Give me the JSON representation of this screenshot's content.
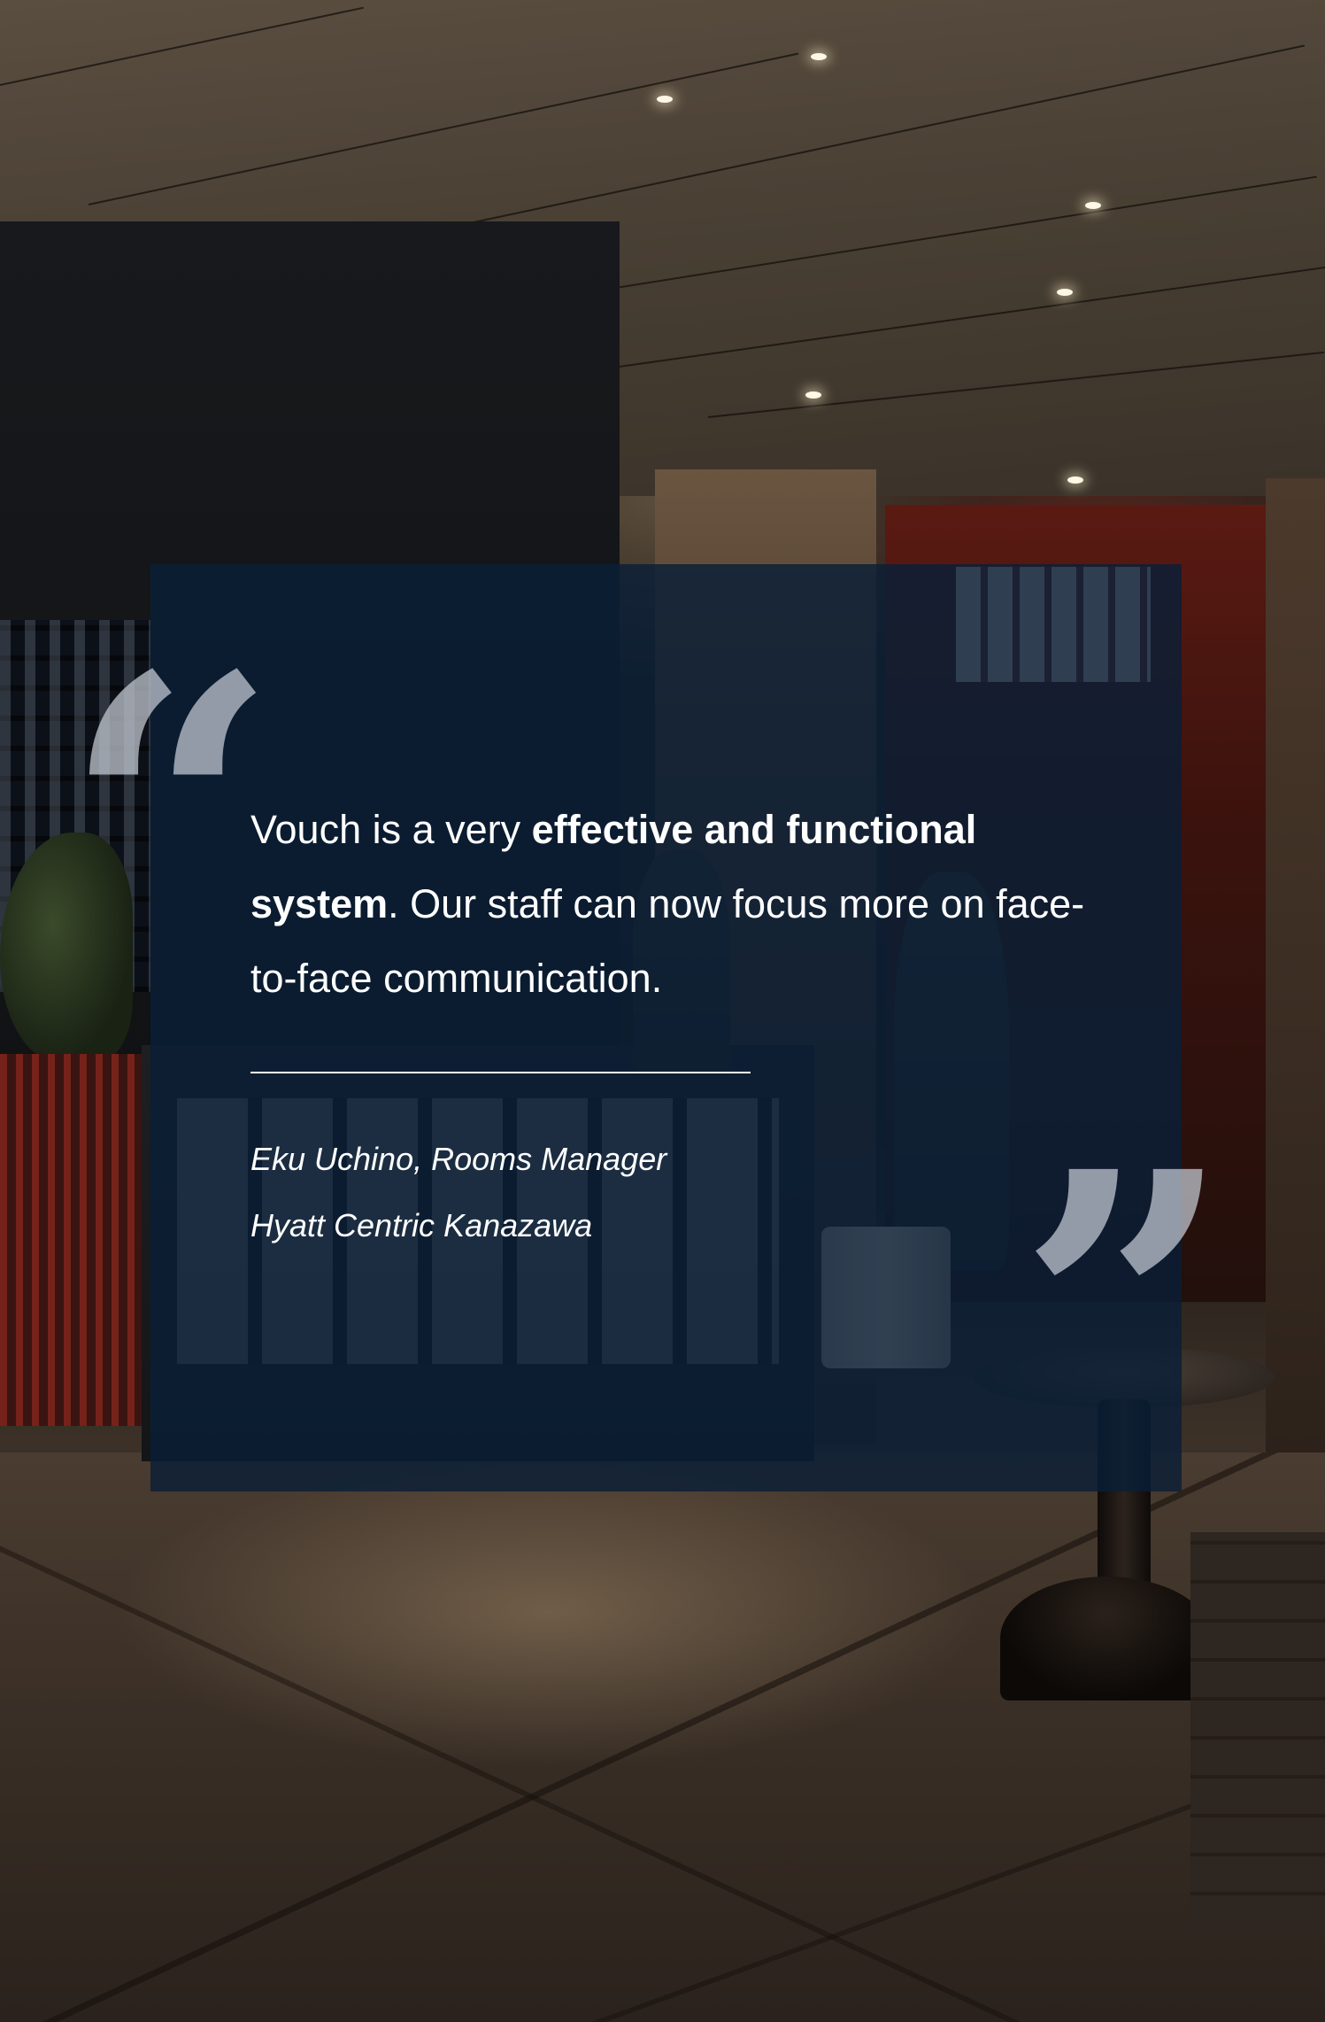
{
  "testimonial": {
    "quote_part1": "Vouch is a very ",
    "quote_emphasis": "effective and functional system",
    "quote_part2": ". Our staff can now focus more on face-to-face communication.",
    "author": "Eku Uchino, Rooms Manager",
    "company": "Hyatt Centric Kanazawa"
  },
  "overlay_color": "#0a1e37",
  "background_scene": "hotel-lobby-photo"
}
